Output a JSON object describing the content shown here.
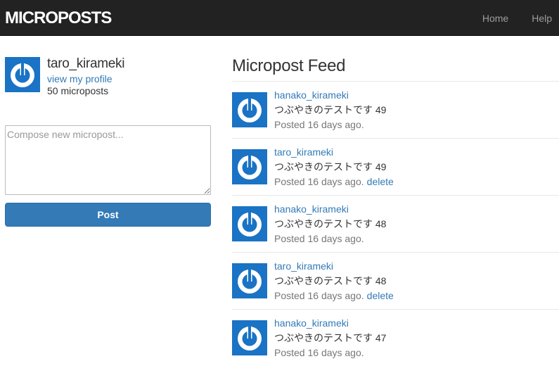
{
  "navbar": {
    "brand": "MICROPOSTS",
    "links": [
      "Home",
      "Help"
    ]
  },
  "sidebar": {
    "user_name": "taro_kirameki",
    "profile_link": "view my profile",
    "micropost_count": "50 microposts",
    "compose_placeholder": "Compose new micropost...",
    "post_button": "Post"
  },
  "feed": {
    "title": "Micropost Feed",
    "items": [
      {
        "user": "hanako_kirameki",
        "content": "つぶやきのテストです 49",
        "timestamp": "Posted 16 days ago.",
        "delete": ""
      },
      {
        "user": "taro_kirameki",
        "content": "つぶやきのテストです 49",
        "timestamp": "Posted 16 days ago.",
        "delete": "delete"
      },
      {
        "user": "hanako_kirameki",
        "content": "つぶやきのテストです 48",
        "timestamp": "Posted 16 days ago.",
        "delete": ""
      },
      {
        "user": "taro_kirameki",
        "content": "つぶやきのテストです 48",
        "timestamp": "Posted 16 days ago.",
        "delete": "delete"
      },
      {
        "user": "hanako_kirameki",
        "content": "つぶやきのテストです 47",
        "timestamp": "Posted 16 days ago.",
        "delete": ""
      }
    ]
  },
  "colors": {
    "navbar_bg": "#222222",
    "link": "#337ab7",
    "gravatar_bg": "#1a73c4",
    "button_bg": "#337ab7"
  },
  "icons": {
    "gravatar": "gravatar-power-icon"
  }
}
